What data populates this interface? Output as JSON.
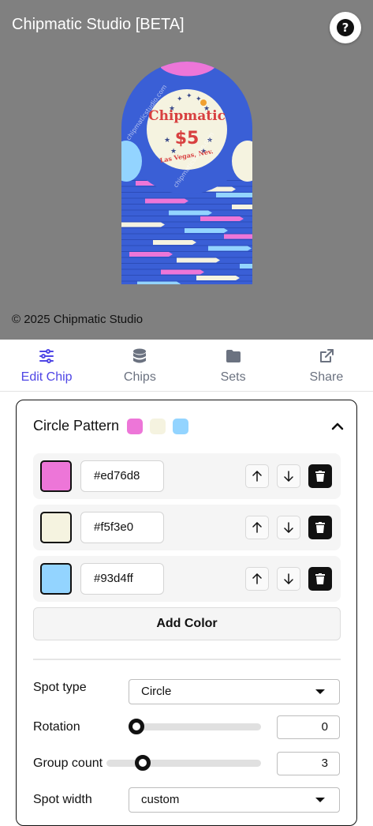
{
  "app": {
    "title": "Chipmatic Studio [BETA]",
    "help_icon": "question-circle-icon",
    "help_glyph": "?",
    "copyright": "© 2025 Chipmatic Studio"
  },
  "chip_preview": {
    "brand": "Chipmatic",
    "denomination": "$5",
    "city": "Las Vegas, Nev.",
    "watermark": "chipmaticstudio.com",
    "body_color": "#3a5fd6"
  },
  "tabs": [
    {
      "label": "Edit Chip",
      "icon": "sliders-icon",
      "active": true
    },
    {
      "label": "Chips",
      "icon": "database-icon",
      "active": false
    },
    {
      "label": "Sets",
      "icon": "folder-icon",
      "active": false
    },
    {
      "label": "Share",
      "icon": "external-link-icon",
      "active": false
    }
  ],
  "panel": {
    "title": "Circle Pattern",
    "expanded": true,
    "colors": [
      {
        "hex": "#ed76d8"
      },
      {
        "hex": "#f5f3e0"
      },
      {
        "hex": "#93d4ff"
      }
    ],
    "add_color_label": "Add Color",
    "fields": {
      "spot_type": {
        "label": "Spot type",
        "value": "Circle"
      },
      "rotation": {
        "label": "Rotation",
        "value": "0",
        "fraction": 0.0
      },
      "group_count": {
        "label": "Group count",
        "value": "3",
        "fraction": 0.11
      },
      "spot_width": {
        "label": "Spot width",
        "value": "custom"
      }
    }
  },
  "accent_color": "#4f46e5"
}
